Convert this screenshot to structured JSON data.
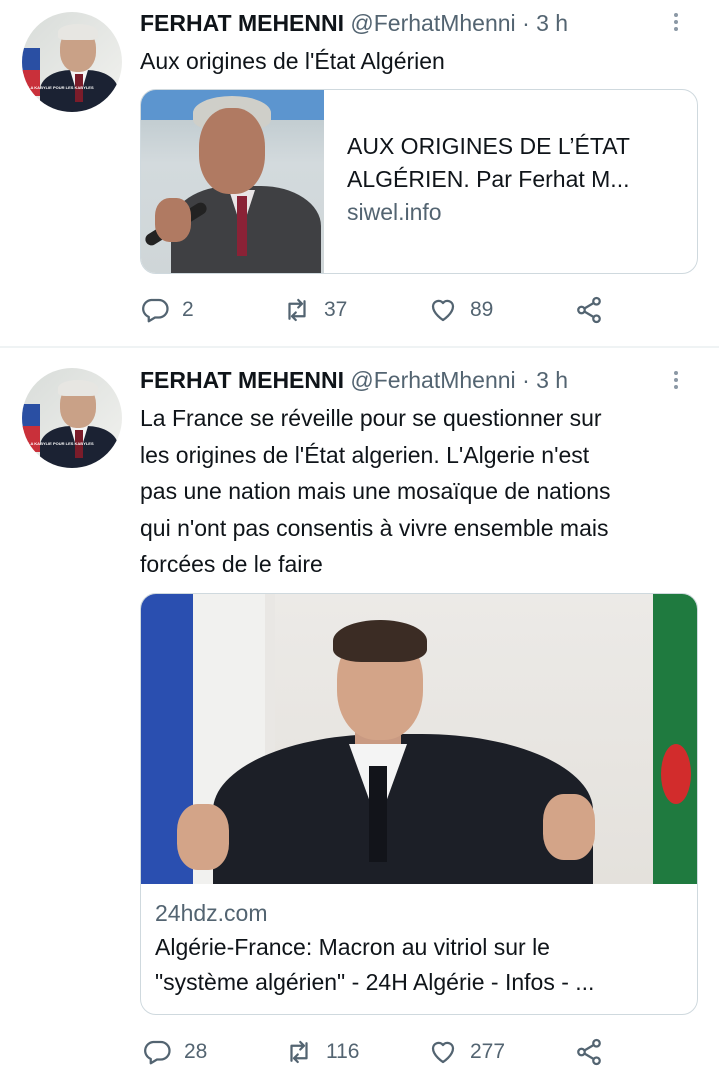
{
  "tweets": [
    {
      "author_name": "FERHAT MEHENNI",
      "handle": "@FerhatMhenni",
      "separator": "·",
      "time": "3 h",
      "avatar_caption": "LA KABYLIE POUR LES KABYLES",
      "text": "Aux origines de l'État Algérien",
      "card": {
        "title_line1": "AUX ORIGINES DE L’ÉTAT",
        "title_line2": "ALGÉRIEN. Par Ferhat M...",
        "domain": "siwel.info"
      },
      "stats": {
        "replies": "2",
        "retweets": "37",
        "likes": "89"
      },
      "icons": [
        "reply-icon",
        "retweet-icon",
        "like-icon",
        "share-icon",
        "more-icon"
      ]
    },
    {
      "author_name": "FERHAT MEHENNI",
      "handle": "@FerhatMhenni",
      "separator": "·",
      "time": "3 h",
      "avatar_caption": "LA KABYLIE POUR LES KABYLES",
      "text_lines": [
        "La France se réveille pour se questionner sur",
        "les origines de l'État algerien. L'Algerie n'est",
        "pas une nation mais une mosaïque de nations",
        "qui n'ont pas consentis à vivre ensemble mais",
        "forcées de le faire"
      ],
      "card": {
        "domain": "24hdz.com",
        "title_line1": "Algérie-France: Macron au vitriol sur le",
        "title_line2": "\"système algérien\" - 24H Algérie - Infos - ..."
      },
      "stats": {
        "replies": "28",
        "retweets": "116",
        "likes": "277"
      },
      "icons": [
        "reply-icon",
        "retweet-icon",
        "like-icon",
        "share-icon",
        "more-icon"
      ]
    }
  ],
  "colors": {
    "text": "#0f1419",
    "secondary": "#536471",
    "border": "#cfd9de"
  }
}
